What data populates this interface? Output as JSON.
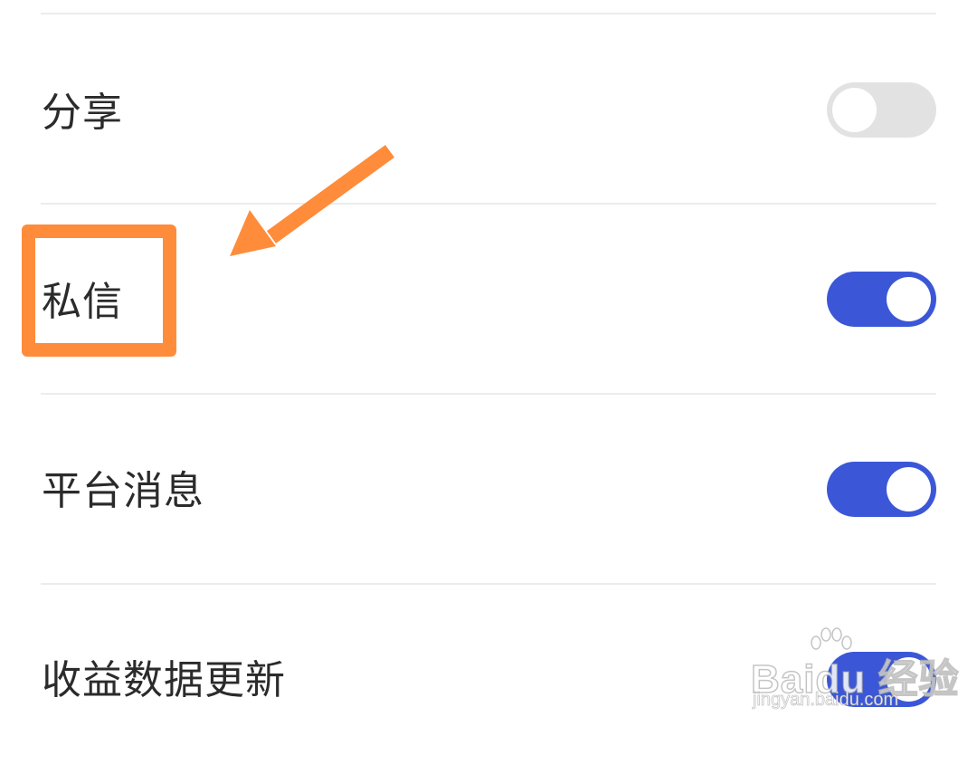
{
  "settings": {
    "items": [
      {
        "label": "分享",
        "enabled": false
      },
      {
        "label": "私信",
        "enabled": true
      },
      {
        "label": "平台消息",
        "enabled": true
      },
      {
        "label": "收益数据更新",
        "enabled": true
      }
    ]
  },
  "annotations": {
    "highlighted_item": "私信",
    "arrow_direction": "down-left",
    "color": "#ff8c3a"
  },
  "watermark": {
    "logo_text": "Baidu 经验",
    "url": "jingyan.baidu.com"
  },
  "colors": {
    "toggle_on": "#3b57d7",
    "toggle_off": "#e2e2e2",
    "divider": "#ececec"
  },
  "icons": [
    "toggle-switch",
    "annotation-arrow",
    "baidu-paw-icon"
  ]
}
